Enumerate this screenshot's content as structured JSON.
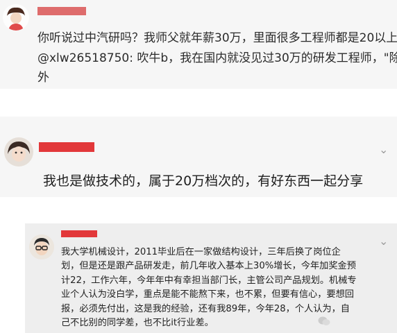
{
  "comments": [
    {
      "lines": [
        "你听说过中汽研吗？我师父就年薪30万，里面很多工程师都是20以上",
        "@xlw26518750:   吹牛b，我在国内就没见过30万的研发工程师，\"除",
        "外"
      ]
    },
    {
      "lines": [
        "我也是做技术的，属于20万档次的，有好东西一起分享"
      ]
    },
    {
      "lines": [
        "我大学机械设计，2011毕业后在一家做结构设计，三年后换了岗位企",
        "划，但是还是跟产品研发走，前几年收入基本上30%增长，今年加奖金预",
        "计22，工作六年，今年年中有幸担当部门长，主管公司产品规划。机械专",
        "业个人认为没白学，重点是能不能熬下来，也不累，但要有信心，要想回",
        "报，必须先付出，这是我的经验，还有我89年，今年28，个人认为，自",
        "己不比别的同学差，也不比it行业差。"
      ]
    }
  ],
  "icons": {
    "chevron": "chevron-down-icon",
    "watermark": "wechat-watermark-icon"
  },
  "colors": {
    "redaction": "#e2383a",
    "card_bg": "#f6f6f6",
    "card3_bg": "#eeeeee"
  }
}
